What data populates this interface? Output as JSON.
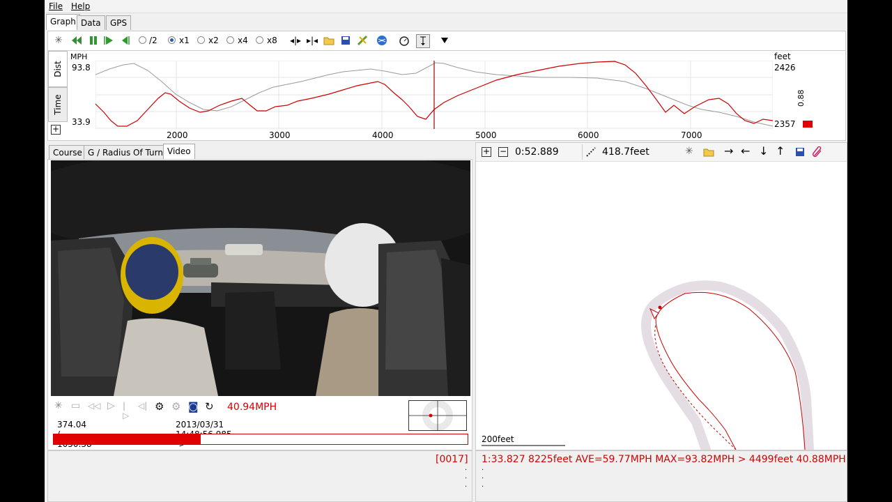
{
  "menu": {
    "file": "File",
    "help": "Help"
  },
  "main_tabs": [
    "Graph",
    "Data",
    "GPS"
  ],
  "graph_toolbar": {
    "speeds": [
      "/2",
      "x1",
      "x2",
      "x4",
      "x8"
    ],
    "selected_speed": "x1"
  },
  "graph": {
    "side_tabs": [
      "Dist",
      "Time"
    ],
    "left_unit": "MPH",
    "left_max": "93.8",
    "left_min": "33.9",
    "right_unit": "feet",
    "right_max": "2426",
    "right_min": "2357",
    "right_vertical_value": "0.88",
    "x_ticks": [
      "2000",
      "3000",
      "4000",
      "5000",
      "6000",
      "7000"
    ],
    "colors": {
      "speed": "#cc0000",
      "altitude": "#888888",
      "cursor": "#a00000"
    }
  },
  "lower_tabs": [
    "Course",
    "G / Radius Of Turn",
    "Video"
  ],
  "video": {
    "speed_readout": "40.94MPH",
    "time_position": "374.04 / 1050.38 sec",
    "timestamp": "2013/03/31 14:48:56.985 ->",
    "progress": 0.356
  },
  "map": {
    "lap_time": "0:52.889",
    "distance": "418.7feet",
    "scale_label": "200feet"
  },
  "status": {
    "left_code": "[0017]",
    "lap_summary": "1:33.827 8225feet AVE=59.77MPH MAX=93.82MPH > 4499feet 40.88MPH"
  }
}
